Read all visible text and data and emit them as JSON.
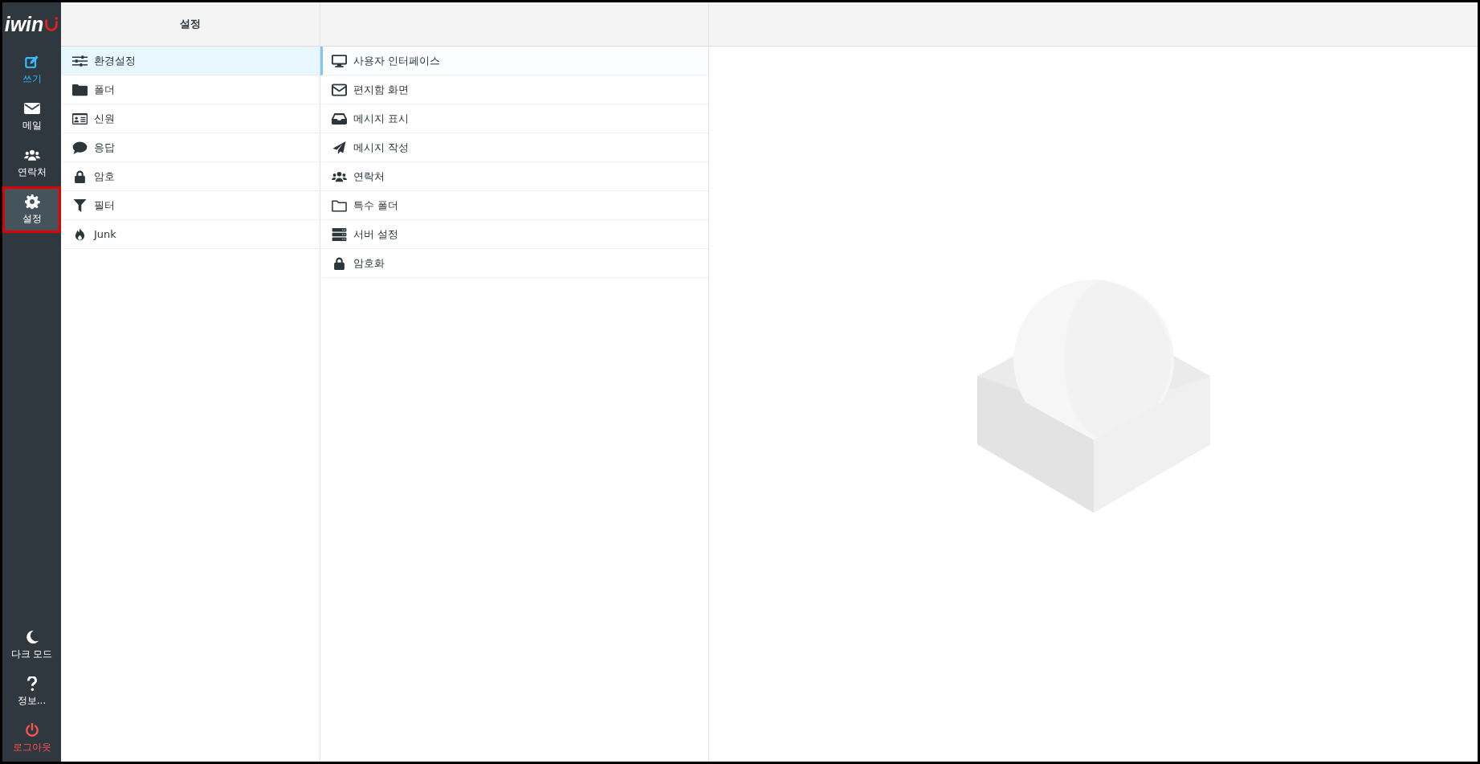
{
  "logo": {
    "text": "iwin"
  },
  "nav_top": [
    {
      "label": "쓰기",
      "kind": "compose",
      "selected": false
    },
    {
      "label": "메일",
      "kind": "mail",
      "selected": false
    },
    {
      "label": "연락처",
      "kind": "contacts",
      "selected": false
    },
    {
      "label": "설정",
      "kind": "settings",
      "selected": true
    }
  ],
  "nav_bottom": [
    {
      "label": "다크 모드",
      "kind": "dark"
    },
    {
      "label": "정보...",
      "kind": "info"
    },
    {
      "label": "로그아웃",
      "kind": "logout"
    }
  ],
  "settings_column": {
    "title": "설정",
    "items": [
      {
        "label": "환경설정",
        "kind": "sliders",
        "selected": true
      },
      {
        "label": "폴더",
        "kind": "folder",
        "selected": false
      },
      {
        "label": "신원",
        "kind": "idcard",
        "selected": false
      },
      {
        "label": "응답",
        "kind": "comment",
        "selected": false
      },
      {
        "label": "암호",
        "kind": "lock",
        "selected": false
      },
      {
        "label": "필터",
        "kind": "filter",
        "selected": false
      },
      {
        "label": "Junk",
        "kind": "fire",
        "selected": false
      }
    ]
  },
  "sections_column": {
    "items": [
      {
        "label": "사용자 인터페이스",
        "kind": "monitor",
        "selected": true
      },
      {
        "label": "편지함 화면",
        "kind": "envelope",
        "selected": false
      },
      {
        "label": "메시지 표시",
        "kind": "inbox",
        "selected": false
      },
      {
        "label": "메시지 작성",
        "kind": "plane",
        "selected": false
      },
      {
        "label": "연락처",
        "kind": "contacts",
        "selected": false
      },
      {
        "label": "특수 폴더",
        "kind": "folder-outline",
        "selected": false
      },
      {
        "label": "서버 설정",
        "kind": "server",
        "selected": false
      },
      {
        "label": "암호화",
        "kind": "lock",
        "selected": false
      }
    ]
  }
}
